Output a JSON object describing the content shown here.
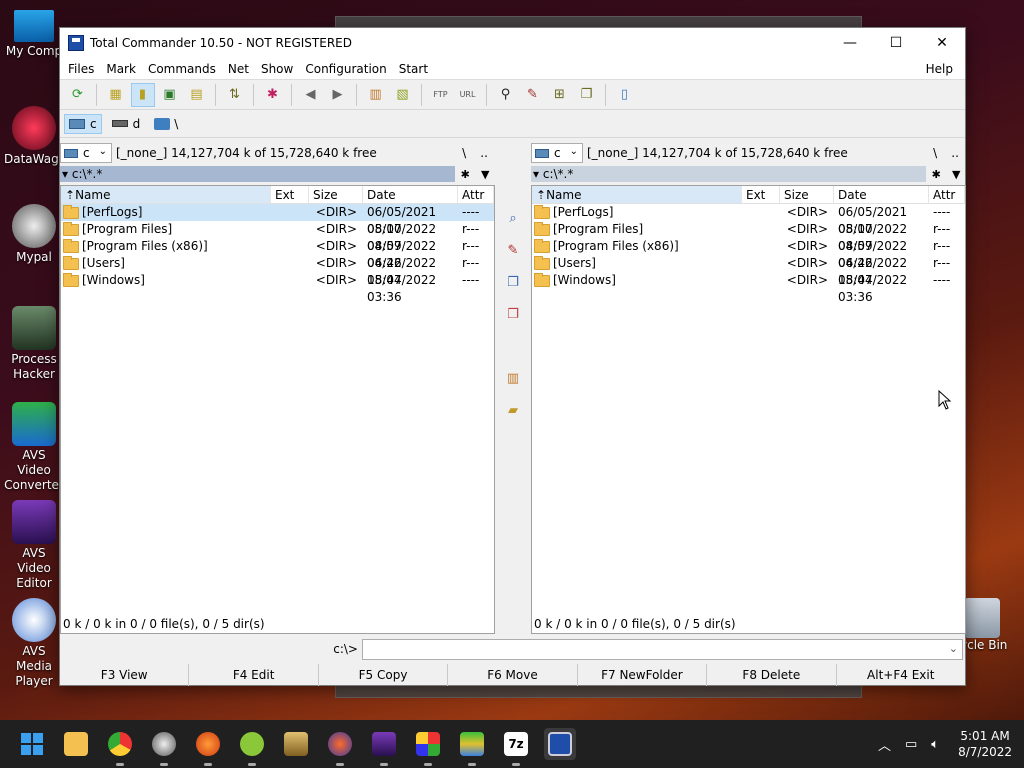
{
  "desktop": {
    "icons": [
      {
        "label": "My Comp"
      },
      {
        "label": "DataWago"
      },
      {
        "label": "Mypal"
      },
      {
        "label": "Process Hacker"
      },
      {
        "label": "AVS Video Converter"
      },
      {
        "label": "AVS Video Editor"
      },
      {
        "label": "AVS Media Player"
      }
    ],
    "recycle_label": "ycle Bin"
  },
  "window": {
    "title": "Total Commander 10.50 - NOT REGISTERED",
    "minimize": "—",
    "maximize": "☐",
    "close": "✕"
  },
  "menu": {
    "items": [
      "Files",
      "Mark",
      "Commands",
      "Net",
      "Show",
      "Configuration",
      "Start"
    ],
    "help": "Help"
  },
  "drives": {
    "c": "c",
    "d": "d",
    "net": "\\"
  },
  "left_panel": {
    "drive": "c",
    "free_text": "[_none_]  14,127,704 k of 15,728,640 k free",
    "root_btn": "\\",
    "up_btn": "..",
    "path": "c:\\*.*",
    "headers": {
      "name": "Name",
      "ext": "Ext",
      "size": "Size",
      "date": "Date",
      "attr": "Attr"
    },
    "rows": [
      {
        "name": "[PerfLogs]",
        "size": "<DIR>",
        "date": "06/05/2021 05:10",
        "attr": "----"
      },
      {
        "name": "[Program Files]",
        "size": "<DIR>",
        "date": "08/07/2022 04:59",
        "attr": "r---"
      },
      {
        "name": "[Program Files (x86)]",
        "size": "<DIR>",
        "date": "08/07/2022 04:46",
        "attr": "r---"
      },
      {
        "name": "[Users]",
        "size": "<DIR>",
        "date": "06/22/2022 15:44",
        "attr": "r---"
      },
      {
        "name": "[Windows]",
        "size": "<DIR>",
        "date": "08/07/2022 03:36",
        "attr": "----"
      }
    ],
    "status": "0 k / 0 k in 0 / 0 file(s), 0 / 5 dir(s)"
  },
  "right_panel": {
    "drive": "c",
    "free_text": "[_none_]  14,127,704 k of 15,728,640 k free",
    "root_btn": "\\",
    "up_btn": "..",
    "path": "c:\\*.*",
    "headers": {
      "name": "Name",
      "ext": "Ext",
      "size": "Size",
      "date": "Date",
      "attr": "Attr"
    },
    "rows": [
      {
        "name": "[PerfLogs]",
        "size": "<DIR>",
        "date": "06/05/2021 05:10",
        "attr": "----"
      },
      {
        "name": "[Program Files]",
        "size": "<DIR>",
        "date": "08/07/2022 04:59",
        "attr": "r---"
      },
      {
        "name": "[Program Files (x86)]",
        "size": "<DIR>",
        "date": "08/07/2022 04:46",
        "attr": "r---"
      },
      {
        "name": "[Users]",
        "size": "<DIR>",
        "date": "06/22/2022 15:44",
        "attr": "r---"
      },
      {
        "name": "[Windows]",
        "size": "<DIR>",
        "date": "08/07/2022 03:36",
        "attr": "----"
      }
    ],
    "status": "0 k / 0 k in 0 / 0 file(s), 0 / 5 dir(s)"
  },
  "cmdline": {
    "prompt": "c:\\>",
    "value": ""
  },
  "fkeys": [
    "F3 View",
    "F4 Edit",
    "F5 Copy",
    "F6 Move",
    "F7 NewFolder",
    "F8 Delete",
    "Alt+F4 Exit"
  ],
  "taskbar": {
    "time": "5:01 AM",
    "date": "8/7/2022",
    "apps": [
      "start-icon",
      "file-explorer-icon",
      "chrome-icon",
      "mypal-icon",
      "audio-app-icon",
      "android-app-icon",
      "keys-app-icon",
      "disc-app-icon",
      "video-app-icon",
      "puzzle-app-icon",
      "bluestacks-icon",
      "7zip-icon",
      "total-commander-icon"
    ],
    "zip_label": "7z"
  }
}
